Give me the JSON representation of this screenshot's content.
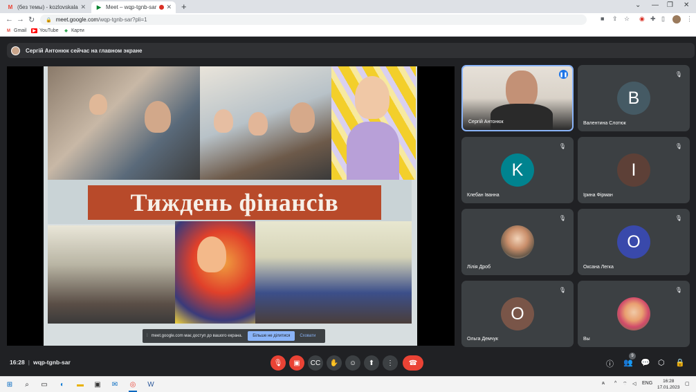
{
  "browser": {
    "tabs": [
      {
        "title": "(без темы) - kozlovskalarusa@g",
        "favicon": "gmail-icon"
      },
      {
        "title": "Meet – wqp-tgnb-sar",
        "favicon": "meet-icon"
      }
    ],
    "url_host": "meet.google.com",
    "url_path": "/wqp-tgnb-sar?pli=1",
    "bookmarks": [
      "Gmail",
      "YouTube",
      "Карти"
    ]
  },
  "meet": {
    "presenter_text": "Сергій Антонюк сейчас на главном экране",
    "slide_title": "Тиждень фінансів",
    "share_notice": {
      "text": "meet.google.com має доступ до вашого екрана.",
      "stop_label": "Більше не ділитися",
      "hide_label": "Сховати"
    },
    "participants": [
      {
        "name": "Сергій Антонюк",
        "initial": "",
        "type": "video",
        "speaking": true
      },
      {
        "name": "Валентина Слотюк",
        "initial": "B",
        "type": "initial",
        "color": "#455a64"
      },
      {
        "name": "Клебан Іванна",
        "initial": "K",
        "type": "initial",
        "color": "#00838f"
      },
      {
        "name": "Ірина Фірман",
        "initial": "I",
        "type": "initial",
        "color": "#5d4037"
      },
      {
        "name": "Лілія Дроб",
        "initial": "",
        "type": "photo"
      },
      {
        "name": "Оксана Легка",
        "initial": "O",
        "type": "initial",
        "color": "#3949ab"
      },
      {
        "name": "Ольга Демчук",
        "initial": "O",
        "type": "initial",
        "color": "#795548"
      },
      {
        "name": "Вы",
        "initial": "",
        "type": "photo"
      }
    ],
    "time": "16:28",
    "meeting_code": "wqp-tgnb-sar",
    "participant_count": "9"
  },
  "taskbar": {
    "language": "ENG",
    "clock_time": "16:28",
    "clock_date": "17.01.2023"
  }
}
